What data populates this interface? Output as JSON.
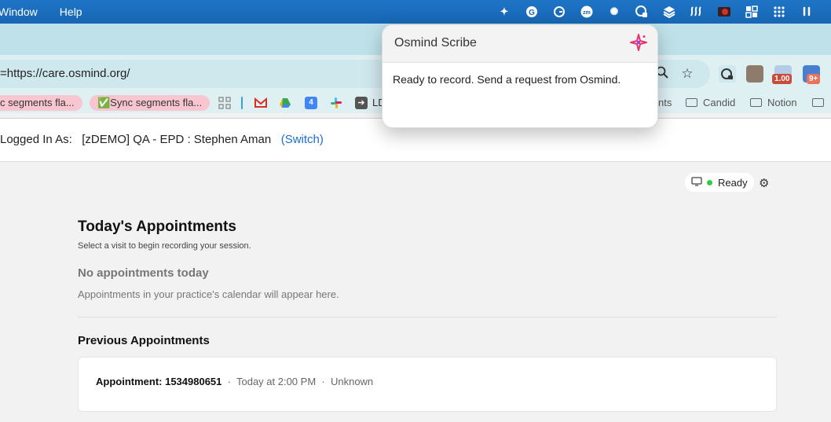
{
  "menubar": {
    "items": [
      "Window",
      "Help"
    ],
    "tray_icons": [
      "gemini-icon",
      "grammarly-icon",
      "grammarly-alt-icon",
      "zoom-icon",
      "claude-icon",
      "vpn-icon",
      "stack-icon",
      "fin-icon",
      "record-icon",
      "dashboard-icon",
      "grid-icon",
      "airpods-icon"
    ]
  },
  "browser": {
    "url": "=https://care.osmind.org/",
    "badges": [
      "1.00",
      "9+"
    ],
    "bookmarks": [
      {
        "label": "c segments  fla..."
      },
      {
        "label": "✅Sync segments  fla..."
      },
      {
        "label": "LD"
      },
      {
        "label": "nts"
      }
    ],
    "folders": [
      "Candid",
      "Notion"
    ]
  },
  "login": {
    "prefix": "Logged In As:",
    "account": "[zDEMO] QA - EPD : Stephen Aman",
    "switch": "(Switch)"
  },
  "status": {
    "label": "Ready",
    "color": "#2ecc40"
  },
  "appointments": {
    "today_title": "Today's Appointments",
    "today_sub": "Select a visit to begin recording your session.",
    "empty_title": "No appointments today",
    "empty_hint": "Appointments in your practice's calendar will appear here.",
    "previous_title": "Previous Appointments",
    "previous": [
      {
        "id": "Appointment: 1534980651",
        "time": "Today at 2:00 PM",
        "status": "Unknown"
      }
    ]
  },
  "popup": {
    "title": "Osmind Scribe",
    "message": "Ready to record. Send a request from Osmind."
  },
  "colors": {
    "accent": "#1a6fd0",
    "brand_pink": "#e6336b"
  }
}
